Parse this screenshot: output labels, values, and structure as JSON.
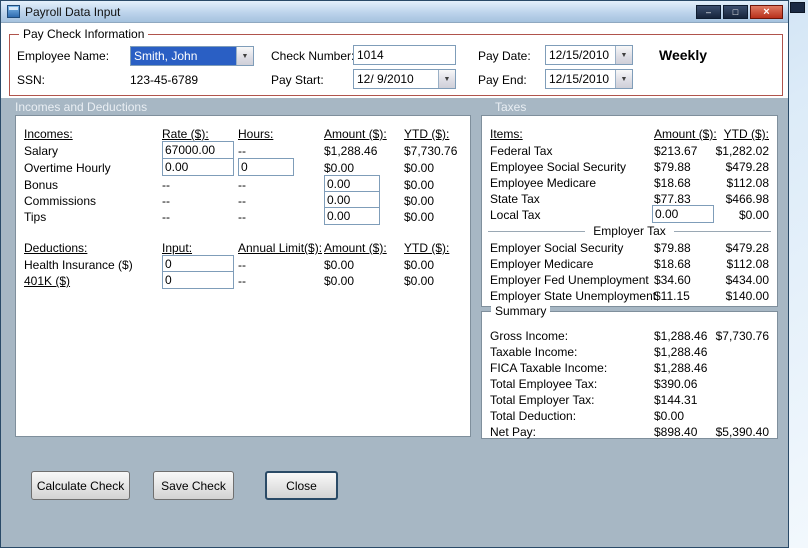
{
  "window": {
    "title": "Payroll Data Input",
    "controls": {
      "minimize": "–",
      "maximize": "□",
      "close": "×"
    }
  },
  "colors": {
    "selection_blue": "#2a5fc4",
    "paycheck_group_border": "#b0544c",
    "lower_background": "#a7b7c4",
    "close_button_red": "#b8301c"
  },
  "paycheck": {
    "group_label": "Pay Check Information",
    "frequency": "Weekly",
    "fields": {
      "employee_name": {
        "label": "Employee Name:",
        "value": "Smith, John"
      },
      "ssn": {
        "label": "SSN:",
        "value": "123-45-6789"
      },
      "check_number": {
        "label": "Check Number:",
        "value": "1014"
      },
      "pay_start": {
        "label": "Pay Start:",
        "value": "12/ 9/2010"
      },
      "pay_date": {
        "label": "Pay Date:",
        "value": "12/15/2010"
      },
      "pay_end": {
        "label": "Pay End:",
        "value": "12/15/2010"
      }
    }
  },
  "sections": {
    "incomes_deductions": "Incomes and Deductions",
    "taxes": "Taxes"
  },
  "incomes": {
    "headers": [
      "Incomes:",
      "Rate ($):",
      "Hours:",
      "Amount ($):",
      "YTD ($):"
    ],
    "rows": [
      {
        "label": "Salary",
        "rate": "67000.00",
        "hours": "--",
        "amount": "$1,288.46",
        "ytd": "$7,730.76"
      },
      {
        "label": "Overtime Hourly",
        "rate": "0.00",
        "hours": "0",
        "amount": "$0.00",
        "ytd": "$0.00"
      },
      {
        "label": "Bonus",
        "rate": "--",
        "hours": "--",
        "amount": "0.00",
        "ytd": "$0.00"
      },
      {
        "label": "Commissions",
        "rate": "--",
        "hours": "--",
        "amount": "0.00",
        "ytd": "$0.00"
      },
      {
        "label": "Tips",
        "rate": "--",
        "hours": "--",
        "amount": "0.00",
        "ytd": "$0.00"
      }
    ]
  },
  "deductions": {
    "headers": [
      "Deductions:",
      "Input:",
      "Annual Limit($):",
      "Amount ($):",
      "YTD ($):"
    ],
    "rows": [
      {
        "label": "Health Insurance  ($)",
        "input": "0",
        "limit": "--",
        "amount": "$0.00",
        "ytd": "$0.00"
      },
      {
        "label": "401K  ($)",
        "input": "0",
        "limit": "--",
        "amount": "$0.00",
        "ytd": "$0.00"
      }
    ]
  },
  "taxes": {
    "headers": [
      "Items:",
      "Amount ($):",
      "YTD ($):"
    ],
    "employee_rows": [
      {
        "label": "Federal Tax",
        "amount": "$213.67",
        "ytd": "$1,282.02"
      },
      {
        "label": "Employee Social Security",
        "amount": "$79.88",
        "ytd": "$479.28"
      },
      {
        "label": "Employee Medicare",
        "amount": "$18.68",
        "ytd": "$112.08"
      },
      {
        "label": "State Tax",
        "amount": "$77.83",
        "ytd": "$466.98"
      },
      {
        "label": "Local Tax",
        "amount": "0.00",
        "ytd": "$0.00"
      }
    ],
    "employer_group_label": "Employer Tax",
    "employer_rows": [
      {
        "label": "Employer Social Security",
        "amount": "$79.88",
        "ytd": "$479.28"
      },
      {
        "label": "Employer Medicare",
        "amount": "$18.68",
        "ytd": "$112.08"
      },
      {
        "label": "Employer Fed Unemployment",
        "amount": "$34.60",
        "ytd": "$434.00"
      },
      {
        "label": "Employer State Unemployment",
        "amount": "$11.15",
        "ytd": "$140.00"
      }
    ]
  },
  "summary": {
    "group_label": "Summary",
    "rows": [
      {
        "label": "Gross Income:",
        "amount": "$1,288.46",
        "ytd": "$7,730.76"
      },
      {
        "label": "Taxable Income:",
        "amount": "$1,288.46",
        "ytd": ""
      },
      {
        "label": "FICA Taxable Income:",
        "amount": "$1,288.46",
        "ytd": ""
      },
      {
        "label": "Total Employee Tax:",
        "amount": "$390.06",
        "ytd": ""
      },
      {
        "label": "Total Employer Tax:",
        "amount": "$144.31",
        "ytd": ""
      },
      {
        "label": "Total Deduction:",
        "amount": "$0.00",
        "ytd": ""
      },
      {
        "label": "Net Pay:",
        "amount": "$898.40",
        "ytd": "$5,390.40"
      }
    ]
  },
  "buttons": {
    "calculate": "Calculate Check",
    "save": "Save Check",
    "close": "Close"
  }
}
